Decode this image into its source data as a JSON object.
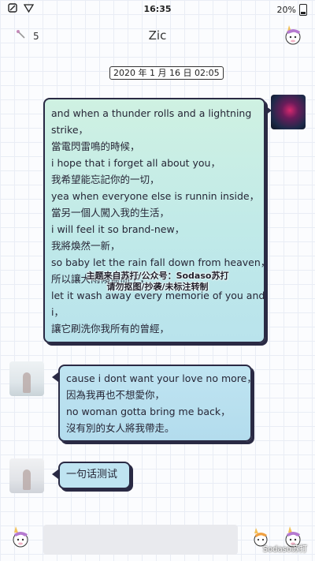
{
  "status_bar": {
    "time": "16:35",
    "battery": "20%",
    "icons": [
      "notification-icon",
      "wifi-icon",
      "battery-icon"
    ]
  },
  "header": {
    "count": "5",
    "title": "Zic"
  },
  "timestamp": "2020 年 1 月 16 日 02:05",
  "messages": [
    {
      "side": "right",
      "lines": [
        "and when a thunder rolls and a lightning",
        "strike，",
        "當電閃雷鳴的時候，",
        "i hope that i forget all about you，",
        "我希望能忘記你的一切，",
        "yea when everyone else is runnin inside，",
        "當另一個人闖入我的生活，",
        "i will feel it so brand-new，",
        "我將煥然一新，",
        "so baby let the rain fall down from heaven，",
        "所以讓大雨傾盆而下，",
        "let it wash away every memorie of you and",
        "i，",
        "讓它刷洗你我所有的曾經，"
      ]
    },
    {
      "side": "left",
      "lines": [
        "cause i dont want your love no more，",
        "因為我再也不想愛你，",
        "no woman gotta bring me back，",
        "沒有別的女人將我帶走。"
      ]
    },
    {
      "side": "left",
      "lines": [
        "一句话测试"
      ]
    }
  ],
  "watermark": {
    "line1": "主题来自苏打/公众号：Sodaso苏打",
    "line2": "请勿抠图/抄袭/未标注转制"
  },
  "footer": {
    "credit": "Sodaso苏打"
  },
  "colors": {
    "bubble_border": "#2a2a44",
    "bubble_right": "#c9eee4",
    "bubble_left": "#bfe4f1",
    "grid_bg": "#fbfcfe"
  }
}
